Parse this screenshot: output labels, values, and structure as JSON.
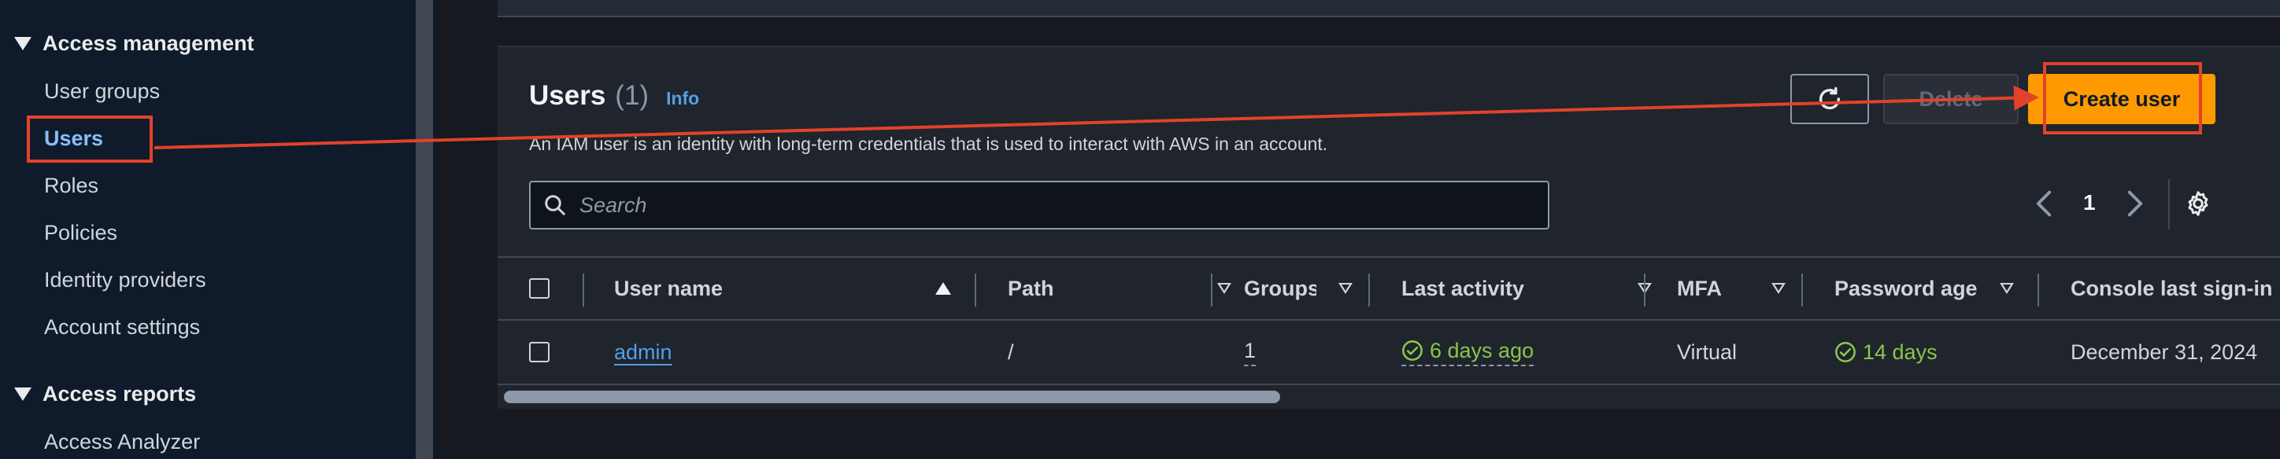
{
  "sidebar": {
    "sections": [
      {
        "label": "Access management"
      },
      {
        "label": "Access reports"
      }
    ],
    "items": [
      {
        "label": "User groups"
      },
      {
        "label": "Users"
      },
      {
        "label": "Roles"
      },
      {
        "label": "Policies"
      },
      {
        "label": "Identity providers"
      },
      {
        "label": "Account settings"
      },
      {
        "label": "Access Analyzer"
      }
    ],
    "active_item": "Users"
  },
  "panel": {
    "title": "Users",
    "count": "(1)",
    "info_link": "Info",
    "description": "An IAM user is an identity with long-term credentials that is used to interact with AWS in an account.",
    "buttons": {
      "delete": "Delete",
      "create": "Create user"
    },
    "search": {
      "placeholder": "Search",
      "value": ""
    },
    "pagination": {
      "current_page": "1"
    }
  },
  "table": {
    "columns": [
      {
        "label": "User name"
      },
      {
        "label": "Path"
      },
      {
        "label": "Groups"
      },
      {
        "label": "Last activity"
      },
      {
        "label": "MFA"
      },
      {
        "label": "Password age"
      },
      {
        "label": "Console last sign-in"
      }
    ],
    "rows": [
      {
        "user_name": "admin",
        "path": "/",
        "groups": "1",
        "last_activity": "6 days ago",
        "mfa": "Virtual",
        "password_age": "14 days",
        "console_last_sign_in": "December 31, 2024"
      }
    ]
  },
  "colors": {
    "accent": "#ff9900",
    "link": "#539fe5",
    "success": "#89c74a",
    "annotation": "#e2422b"
  }
}
